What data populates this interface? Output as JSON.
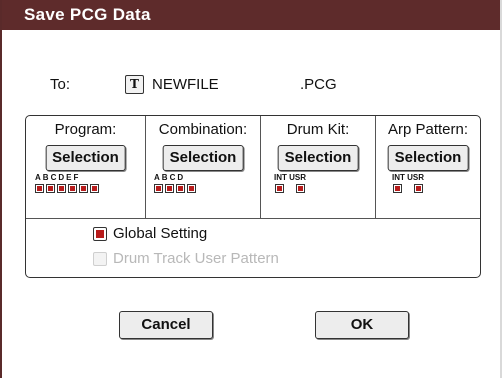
{
  "dialog": {
    "title": "Save PCG Data"
  },
  "to": {
    "label": "To:",
    "filename": "NEWFILE",
    "extension": ".PCG",
    "text_icon": "T"
  },
  "columns": [
    {
      "title": "Program:",
      "button": "Selection",
      "banks": [
        "A",
        "B",
        "C",
        "D",
        "E",
        "F"
      ]
    },
    {
      "title": "Combination:",
      "button": "Selection",
      "banks": [
        "A",
        "B",
        "C",
        "D"
      ]
    },
    {
      "title": "Drum Kit:",
      "button": "Selection",
      "banks": [
        "INT",
        "USR"
      ]
    },
    {
      "title": "Arp Pattern:",
      "button": "Selection",
      "banks": [
        "INT",
        "USR"
      ]
    }
  ],
  "options": {
    "global_setting": {
      "label": "Global Setting",
      "checked": true,
      "enabled": true
    },
    "drum_track": {
      "label": "Drum Track User Pattern",
      "checked": false,
      "enabled": false
    }
  },
  "buttons": {
    "cancel": "Cancel",
    "ok": "OK"
  },
  "colors": {
    "title_bar": "#5e2b2b",
    "check_fill": "#b81c1c"
  }
}
